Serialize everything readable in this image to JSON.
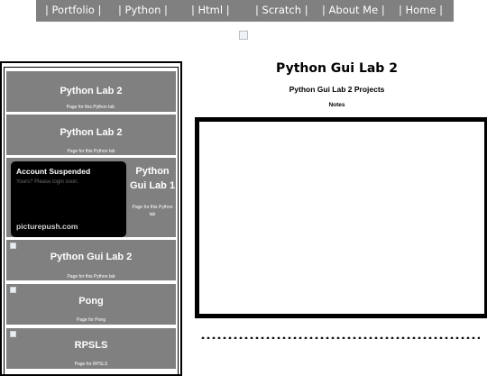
{
  "nav": {
    "items": [
      "| Portfolio |",
      "| Python |",
      "| Html |",
      "| Scratch |",
      "| About Me |",
      "| Home |"
    ]
  },
  "sidebar": {
    "cards": [
      {
        "title": "Python Lab 2",
        "desc": "Page for this Python lab."
      },
      {
        "title": "Python Lab 2",
        "desc": "Page for this Python lab"
      },
      {
        "title": "Python Gui Lab 1",
        "desc": "Page for this Python lab"
      },
      {
        "title": "Python Gui Lab 2",
        "desc": "Page for this Python lab"
      },
      {
        "title": "Pong",
        "desc": "Page for Pong"
      },
      {
        "title": "RPSLS",
        "desc": "Page for RPSLS"
      }
    ],
    "suspended": {
      "heading": "Account Suspended",
      "sub": "Yours? Please login soon.",
      "footer": "picturepush.com"
    }
  },
  "main": {
    "title": "Python Gui Lab 2",
    "subtitle": "Python Gui Lab 2 Projects",
    "notes_label": "Notes"
  },
  "colors": {
    "nav_bg": "#808080",
    "card_bg": "#808080",
    "suspended_bg": "#000000"
  }
}
